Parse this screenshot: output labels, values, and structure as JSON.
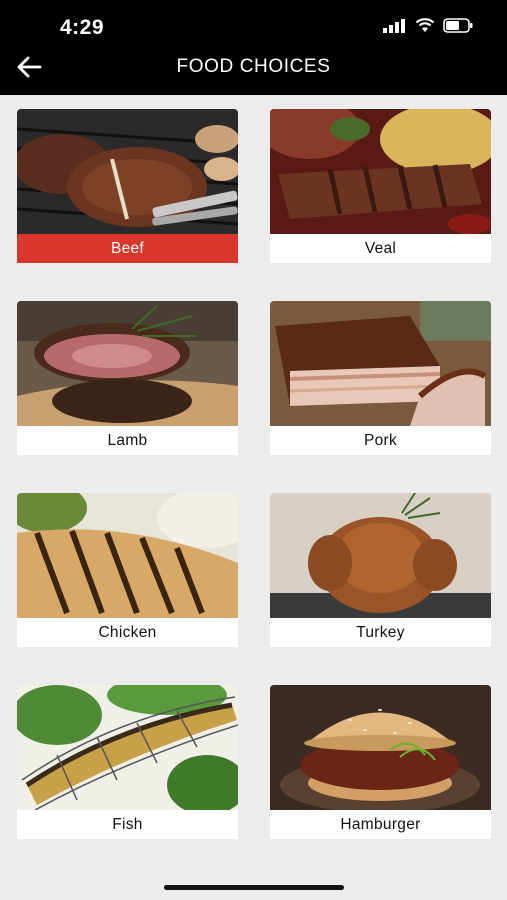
{
  "status_bar": {
    "time": "4:29"
  },
  "header": {
    "title": "FOOD CHOICES"
  },
  "accent_color": "#d9372b",
  "selected_item": "Beef",
  "items": [
    {
      "label": "Beef",
      "image": "grilled-t-bone-steak"
    },
    {
      "label": "Veal",
      "image": "veal-with-pasta"
    },
    {
      "label": "Lamb",
      "image": "lamb-roast-with-rosemary"
    },
    {
      "label": "Pork",
      "image": "pork-belly"
    },
    {
      "label": "Chicken",
      "image": "grilled-chicken-breast"
    },
    {
      "label": "Turkey",
      "image": "roast-turkey"
    },
    {
      "label": "Fish",
      "image": "grilled-fish-in-basket"
    },
    {
      "label": "Hamburger",
      "image": "pulled-pork-burger"
    }
  ]
}
